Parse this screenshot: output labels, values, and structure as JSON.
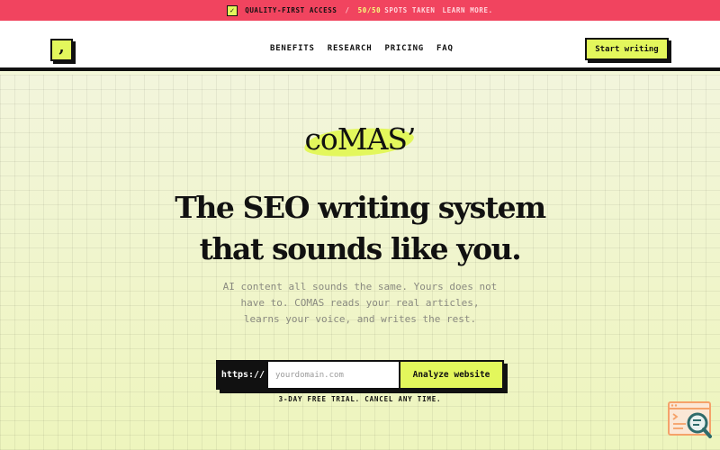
{
  "announcement": {
    "check_symbol": "✓",
    "label": "QUALITY-FIRST ACCESS",
    "separator": "/",
    "spots_count": "50/50",
    "spots_label": "SPOTS TAKEN",
    "link": "LEARN MORE."
  },
  "header": {
    "logo_glyph": ",",
    "nav": [
      "BENEFITS",
      "RESEARCH",
      "PRICING",
      "FAQ"
    ],
    "cta_label": "Start writing"
  },
  "hero": {
    "brand": "coMAS’",
    "headline_line1": "The SEO writing system",
    "headline_line2": "that sounds like you.",
    "sub_line1": "AI content all sounds the same. Yours does not",
    "sub_line2": "have to. COMAS reads your real articles,",
    "sub_line3": "learns your voice, and writes the rest.",
    "form": {
      "prefix": "https://",
      "placeholder": "yourdomain.com",
      "value": "",
      "submit_label": "Analyze website"
    },
    "trial_note": "3-DAY FREE TRIAL. CANCEL ANY TIME."
  },
  "widget": {
    "icon": "search-document-icon"
  },
  "colors": {
    "announcement_bg": "#f1445f",
    "accent": "#e3f75c",
    "ink": "#111111",
    "hero_bg": "#f3f7d6",
    "widget_orange": "#f5a26a",
    "widget_teal": "#2f6b6b"
  }
}
